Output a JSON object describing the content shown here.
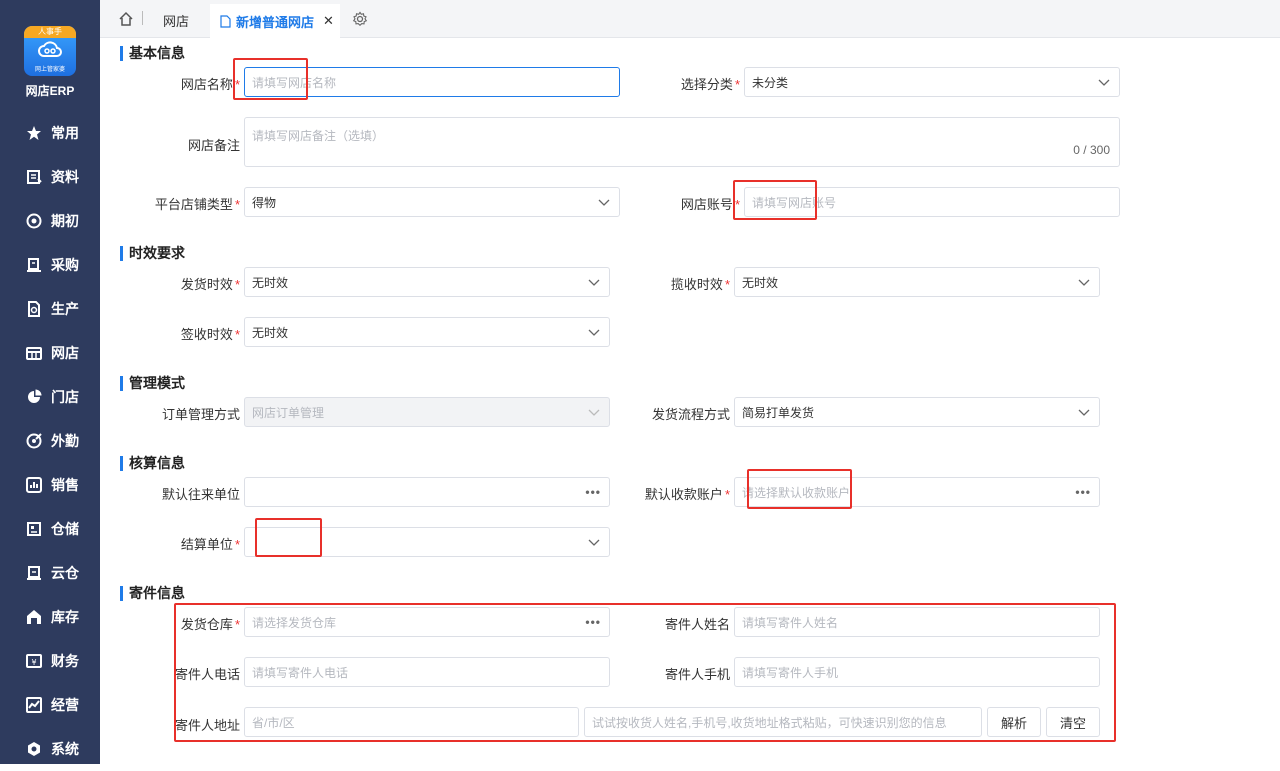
{
  "sidebar": {
    "logo_badge": "人事手",
    "logo_sub": "网上管家婆",
    "brand": "网店ERP",
    "items": [
      {
        "label": "常用",
        "icon": "star-icon"
      },
      {
        "label": "资料",
        "icon": "document-icon"
      },
      {
        "label": "期初",
        "icon": "target-icon"
      },
      {
        "label": "采购",
        "icon": "purchase-icon"
      },
      {
        "label": "生产",
        "icon": "production-icon"
      },
      {
        "label": "网店",
        "icon": "shop-icon"
      },
      {
        "label": "门店",
        "icon": "pie-icon"
      },
      {
        "label": "外勤",
        "icon": "field-icon"
      },
      {
        "label": "销售",
        "icon": "sales-chart-icon"
      },
      {
        "label": "仓储",
        "icon": "warehouse-icon"
      },
      {
        "label": "云仓",
        "icon": "cloud-warehouse-icon"
      },
      {
        "label": "库存",
        "icon": "inventory-icon"
      },
      {
        "label": "财务",
        "icon": "finance-icon"
      },
      {
        "label": "经营",
        "icon": "business-icon"
      },
      {
        "label": "系统",
        "icon": "system-icon"
      }
    ]
  },
  "topbar": {
    "tab_shop": "网店",
    "tab_active": "新增普通网店",
    "close": "✕"
  },
  "sections": {
    "basic": "基本信息",
    "timeliness": "时效要求",
    "management": "管理模式",
    "accounting": "核算信息",
    "sender": "寄件信息"
  },
  "required_mark": "*",
  "form": {
    "shop_name": {
      "label": "网店名称",
      "placeholder": "请填写网店名称"
    },
    "category": {
      "label": "选择分类",
      "value": "未分类"
    },
    "remark": {
      "label": "网店备注",
      "placeholder": "请填写网店备注（选填）",
      "counter": "0 / 300"
    },
    "platform_type": {
      "label": "平台店铺类型",
      "value": "得物"
    },
    "shop_account": {
      "label": "网店账号",
      "placeholder": "请填写网店账号"
    },
    "ship_time": {
      "label": "发货时效",
      "value": "无时效"
    },
    "pickup_time": {
      "label": "揽收时效",
      "value": "无时效"
    },
    "sign_time": {
      "label": "签收时效",
      "value": "无时效"
    },
    "order_mode": {
      "label": "订单管理方式",
      "value": "网店订单管理"
    },
    "ship_flow": {
      "label": "发货流程方式",
      "value": "简易打单发货"
    },
    "default_partner": {
      "label": "默认往来单位",
      "value": ""
    },
    "default_account": {
      "label": "默认收款账户",
      "placeholder": "请选择默认收款账户"
    },
    "settle_unit": {
      "label": "结算单位",
      "value": ""
    },
    "warehouse": {
      "label": "发货仓库",
      "placeholder": "请选择发货仓库"
    },
    "sender_name": {
      "label": "寄件人姓名",
      "placeholder": "请填写寄件人姓名"
    },
    "sender_phone": {
      "label": "寄件人电话",
      "placeholder": "请填写寄件人电话"
    },
    "sender_mobile": {
      "label": "寄件人手机",
      "placeholder": "请填写寄件人手机"
    },
    "sender_address": {
      "label": "寄件人地址",
      "placeholder": "省/市/区"
    },
    "address_parse": {
      "placeholder": "试试按收货人姓名,手机号,收货地址格式粘贴，可快速识别您的信息"
    },
    "parse_button": "解析",
    "clear_button": "清空"
  },
  "colors": {
    "sidebar": "#2e3b5e",
    "accent": "#1f7be8",
    "required": "#e33333",
    "highlight": "#e8302a"
  }
}
